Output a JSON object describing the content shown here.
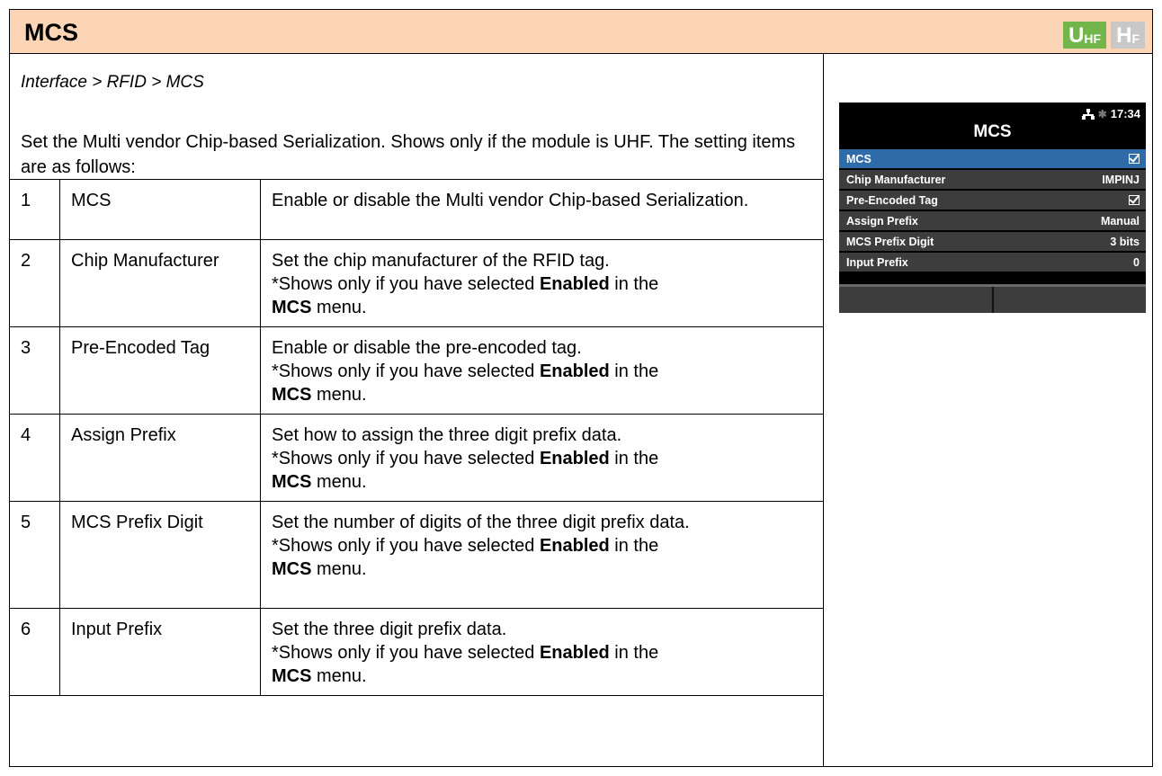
{
  "header": {
    "title": "MCS",
    "badges": [
      {
        "main": "U",
        "sub": "HF",
        "color": "#72b64b"
      },
      {
        "main": "H",
        "sub": "F",
        "color": "#c8c8c8"
      }
    ]
  },
  "breadcrumb": "Interface > RFID > MCS",
  "intro": "Set the Multi vendor Chip-based Serialization. Shows only if the module is UHF. The setting items are as follows:",
  "common": {
    "shows_prefix": "*Shows only if you have selected ",
    "enabled": "Enabled",
    "in_the": " in the ",
    "mcs": "MCS",
    "menu": " menu."
  },
  "items": [
    {
      "num": "1",
      "name": "MCS",
      "desc": "Enable or disable the Multi vendor Chip-based Serialization."
    },
    {
      "num": "2",
      "name": "Chip Manufacturer",
      "desc": "Set the chip manufacturer of the RFID tag."
    },
    {
      "num": "3",
      "name": "Pre-Encoded Tag",
      "desc": "Enable or disable the pre-encoded tag."
    },
    {
      "num": "4",
      "name": "Assign Prefix",
      "desc": "Set how to assign the three digit prefix data."
    },
    {
      "num": "5",
      "name": "MCS Prefix Digit",
      "desc": "Set the number of digits of the three digit prefix data."
    },
    {
      "num": "6",
      "name": "Input Prefix",
      "desc": "Set the three digit prefix data."
    }
  ],
  "device": {
    "time": "17:34",
    "title": "MCS",
    "menu": [
      {
        "label": "MCS",
        "value": "",
        "checked": true
      },
      {
        "label": "Chip Manufacturer",
        "value": "IMPINJ"
      },
      {
        "label": "Pre-Encoded Tag",
        "value": "",
        "checked": true
      },
      {
        "label": "Assign Prefix",
        "value": "Manual"
      },
      {
        "label": "MCS Prefix Digit",
        "value": "3 bits"
      },
      {
        "label": "Input Prefix",
        "value": "0"
      }
    ]
  }
}
